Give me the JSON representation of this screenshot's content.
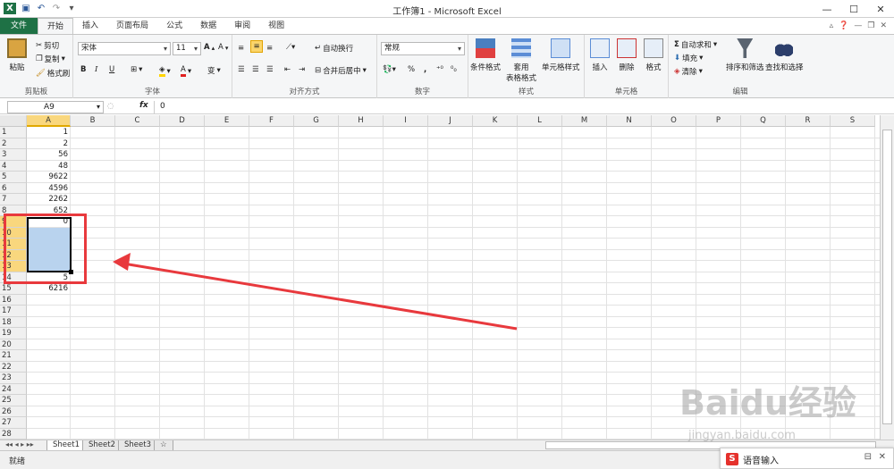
{
  "window": {
    "title": "工作簿1 - Microsoft Excel",
    "undo_icon": "undo-icon",
    "redo_icon": "redo-icon"
  },
  "tabs": [
    {
      "label": "文件"
    },
    {
      "label": "开始"
    },
    {
      "label": "插入"
    },
    {
      "label": "页面布局"
    },
    {
      "label": "公式"
    },
    {
      "label": "数据"
    },
    {
      "label": "审阅"
    },
    {
      "label": "视图"
    }
  ],
  "ribbon": {
    "clipboard": {
      "title": "剪贴板",
      "paste": "粘贴",
      "cut": "剪切",
      "copy": "复制",
      "format_painter": "格式刷"
    },
    "font": {
      "title": "字体",
      "font_name": "宋体",
      "font_size": "11",
      "bold": "B",
      "italic": "I",
      "underline": "U",
      "color_a": "A",
      "ruby": "变"
    },
    "alignment": {
      "title": "对齐方式",
      "wrap": "自动换行",
      "merge": "合并后居中"
    },
    "number": {
      "title": "数字",
      "format": "常规",
      "percent": "%",
      "comma": ","
    },
    "styles": {
      "title": "样式",
      "conditional": "条件格式",
      "table": "套用\n表格格式",
      "cell_style": "单元格样式"
    },
    "cells": {
      "title": "单元格",
      "insert": "插入",
      "delete": "删除",
      "format": "格式"
    },
    "editing": {
      "title": "编辑",
      "autosum": "自动求和",
      "fill": "填充",
      "clear": "清除",
      "sort": "排序和筛选",
      "find": "查找和选择"
    }
  },
  "formula_bar": {
    "name_box": "A9",
    "fx": "fx",
    "value": "0"
  },
  "columns": [
    "A",
    "B",
    "C",
    "D",
    "E",
    "F",
    "G",
    "H",
    "I",
    "J",
    "K",
    "L",
    "M",
    "N",
    "O",
    "P",
    "Q",
    "R",
    "S"
  ],
  "rows": [
    "1",
    "2",
    "3",
    "4",
    "5",
    "6",
    "7",
    "8",
    "9",
    "10",
    "11",
    "12",
    "13",
    "14",
    "15",
    "16",
    "17",
    "18",
    "19",
    "20",
    "21",
    "22",
    "23",
    "24",
    "25",
    "26",
    "27",
    "28"
  ],
  "column_a": [
    "1",
    "2",
    "56",
    "48",
    "9622",
    "4596",
    "2262",
    "652",
    "0",
    "",
    "",
    "",
    "",
    "5",
    "6216"
  ],
  "sheets": [
    "Sheet1",
    "Sheet2",
    "Sheet3"
  ],
  "status": "就绪",
  "ime": {
    "label": "语音输入"
  },
  "watermark": {
    "brand": "Baidu经验",
    "url": "jingyan.baidu.com"
  },
  "colors": {
    "excel_green": "#1e7145",
    "selection_fill": "#b9d3ee",
    "header_selected": "#f9d77e",
    "annotation_red": "#e8393d"
  }
}
